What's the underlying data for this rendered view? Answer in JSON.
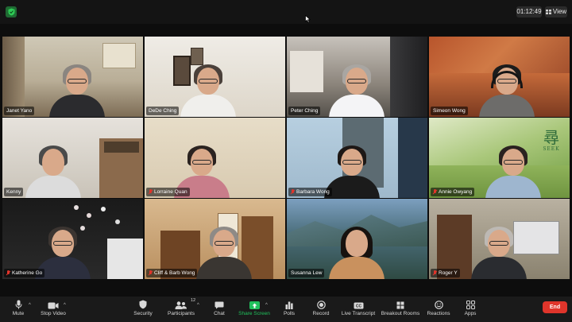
{
  "meeting": {
    "timer": "01:12:49",
    "view_label": "View"
  },
  "colors": {
    "background": "#0d0d0d",
    "toolbar": "#1a1a1a",
    "active_speaker_border": "#e5c94b",
    "share_screen_green": "#20c05c",
    "end_red": "#e0352b"
  },
  "participants": [
    {
      "name": "Janet Yano",
      "muted": false,
      "active": false
    },
    {
      "name": "DeDe Ching",
      "muted": false,
      "active": false
    },
    {
      "name": "Peter Ching",
      "muted": false,
      "active": false
    },
    {
      "name": "Simeon Wong",
      "muted": false,
      "active": false
    },
    {
      "name": "Kenny",
      "muted": false,
      "active": false
    },
    {
      "name": "Lorraine Quan",
      "muted": true,
      "active": false
    },
    {
      "name": "Barbara Wong",
      "muted": true,
      "active": false
    },
    {
      "name": "Annie Owyang",
      "muted": true,
      "active": false
    },
    {
      "name": "Katherine Go",
      "muted": true,
      "active": false
    },
    {
      "name": "Cliff & Barb Wong",
      "muted": true,
      "active": false
    },
    {
      "name": "Susanna Lew",
      "muted": false,
      "active": true
    },
    {
      "name": "Roger Y",
      "muted": true,
      "active": false
    }
  ],
  "seek_logo": {
    "glyph": "尋",
    "word": "SEEK"
  },
  "toolbar": {
    "mute": "Mute",
    "stop_video": "Stop Video",
    "security": "Security",
    "participants": "Participants",
    "participants_count": "12",
    "chat": "Chat",
    "share_screen": "Share Screen",
    "polls": "Polls",
    "record": "Record",
    "live_transcript": "Live Transcript",
    "breakout_rooms": "Breakout Rooms",
    "reactions": "Reactions",
    "apps": "Apps",
    "end": "End"
  }
}
